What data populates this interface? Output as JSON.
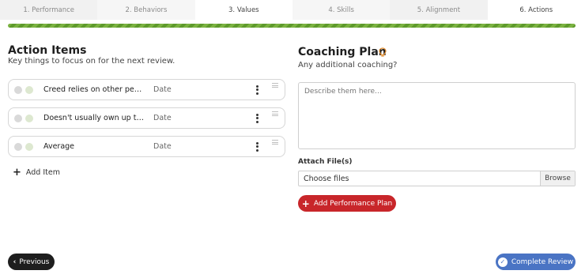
{
  "tabs": [
    {
      "label": "1. Performance"
    },
    {
      "label": "2. Behaviors"
    },
    {
      "label": "3. Values"
    },
    {
      "label": "4. Skills"
    },
    {
      "label": "5. Alignment"
    },
    {
      "label": "6. Actions"
    }
  ],
  "active_tab": "6. Actions",
  "progress": {
    "percent": 100,
    "color": "#7cb342"
  },
  "action_items": {
    "title": "Action Items",
    "subtitle": "Key things to focus on for the next review.",
    "date_placeholder": "Date",
    "items": [
      {
        "text": "Creed relies on other peop..."
      },
      {
        "text": "Doesn't usually own up to ..."
      },
      {
        "text": "Average"
      }
    ],
    "add_label": "Add Item"
  },
  "coaching": {
    "title": "Coaching Plan",
    "subtitle": "Any additional coaching?",
    "textarea_placeholder": "Describe them here...",
    "attach_label": "Attach File(s)",
    "file_text": "Choose files",
    "browse_label": "Browse",
    "add_plan_label": "Add Performance Plan",
    "icon": "lightbulb-icon"
  },
  "footer": {
    "previous_label": "Previous",
    "complete_label": "Complete Review"
  },
  "colors": {
    "accent_red": "#c8262a",
    "accent_blue": "#4a74c4",
    "progress_green": "#7cb342"
  }
}
